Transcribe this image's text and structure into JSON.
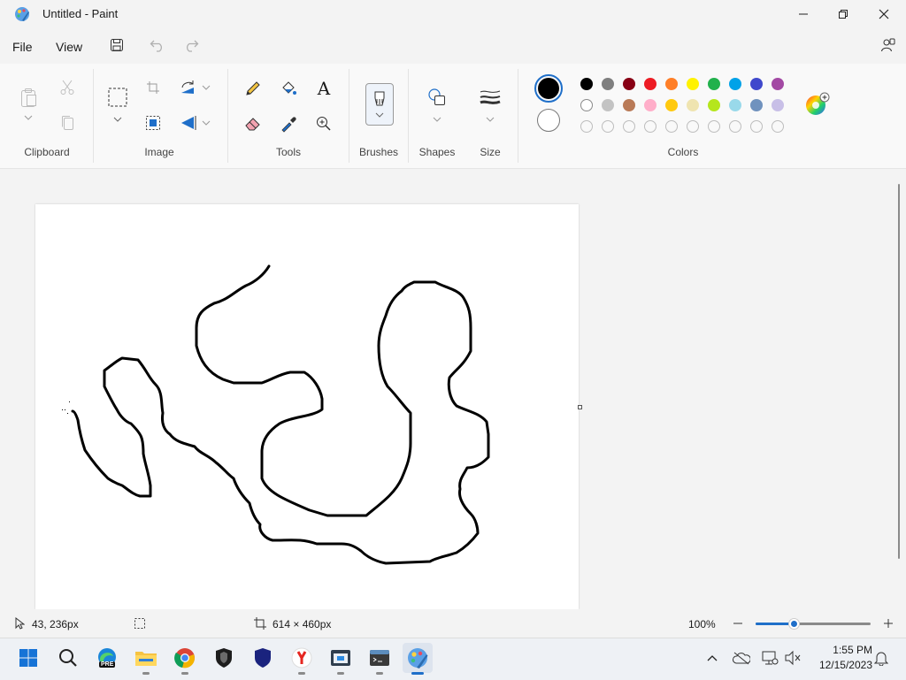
{
  "window": {
    "title": "Untitled - Paint"
  },
  "menu": {
    "file": "File",
    "view": "View"
  },
  "ribbon": {
    "groups": {
      "clipboard": "Clipboard",
      "image": "Image",
      "tools": "Tools",
      "brushes": "Brushes",
      "shapes": "Shapes",
      "size": "Size",
      "colors": "Colors"
    },
    "text_tool_glyph": "A",
    "primary_color": "#000000",
    "secondary_color": "#ffffff",
    "palette_row1": [
      "#000000",
      "#7f7f7f",
      "#880015",
      "#ed1c24",
      "#ff7f27",
      "#fff200",
      "#22b14c",
      "#00a2e8",
      "#3f48cc",
      "#a349a4"
    ],
    "palette_row2": [
      "#ffffff",
      "#c3c3c3",
      "#b97a57",
      "#ffaec9",
      "#ffc90e",
      "#efe4b0",
      "#b5e61d",
      "#99d9ea",
      "#7092be",
      "#c8bfe7"
    ]
  },
  "status": {
    "cursor_pos": "43, 236px",
    "canvas_size": "614 × 460px",
    "zoom": "100%",
    "zoom_level": 0.33
  },
  "taskbar": {
    "time": "1:55 PM",
    "date": "12/15/2023",
    "edge_badge": "PRE"
  }
}
